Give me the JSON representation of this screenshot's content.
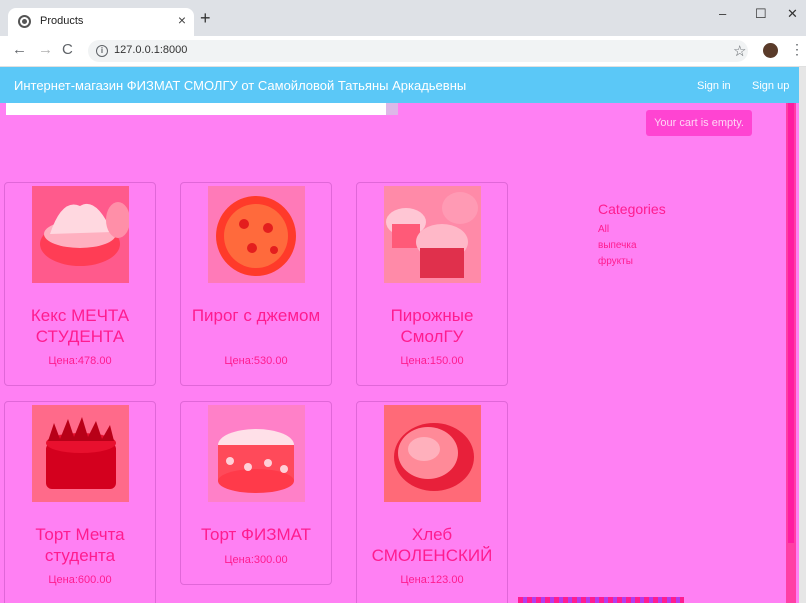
{
  "browser": {
    "tab_title": "Products",
    "tab_close": "×",
    "new_tab": "+",
    "url": "127.0.0.1:8000",
    "window_controls": {
      "minimize": "–",
      "maximize": "☐",
      "close": "✕"
    },
    "nav": {
      "back": "←",
      "forward": "→",
      "reload": "C"
    },
    "info": "i",
    "star": "☆",
    "menu": "⋮"
  },
  "site": {
    "brand": "Интернет-магазин ФИЗМАТ СМОЛГУ от Самойловой Татьяны Аркадьевны",
    "signin": "Sign in",
    "signup": "Sign up"
  },
  "cart": {
    "label": "Your cart is empty."
  },
  "sidebar": {
    "title": "Categories",
    "items": [
      {
        "label": "All"
      },
      {
        "label": "выпечка"
      },
      {
        "label": "фрукты"
      }
    ]
  },
  "products": [
    {
      "name": "Кекс МЕЧТА СТУДЕНТА",
      "price": "Цена:478.00",
      "icon": "cake-image"
    },
    {
      "name": "Пирог с джемом",
      "price": "Цена:530.00",
      "icon": "pie-image"
    },
    {
      "name": "Пирожные СмолГУ",
      "price": "Цена:150.00",
      "icon": "cupcakes-image"
    },
    {
      "name": "Торт Мечта студента",
      "price": "Цена:600.00",
      "icon": "cake-image"
    },
    {
      "name": "Торт ФИЗМАТ",
      "price": "Цена:300.00",
      "icon": "cake-image"
    },
    {
      "name": "Хлеб СМОЛЕНСКИЙ",
      "price": "Цена:123.00",
      "icon": "bread-image"
    }
  ],
  "colors": {
    "navbar": "#5bc8f7",
    "overlay": "#ff80f3",
    "accent_text": "#ff1c8f",
    "cart_button": "#ff44d2"
  }
}
